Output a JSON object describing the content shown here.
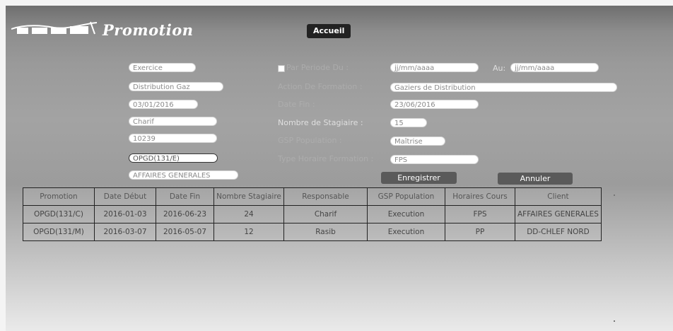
{
  "header": {
    "app_title": "Promotion"
  },
  "nav": {
    "items": [
      "Accueil"
    ]
  },
  "form": {
    "exercice_value": "Exercice",
    "par_periode_label": "Par Periode Du :",
    "date_du_value": "jj/mm/aaaa",
    "au_label": "Au:",
    "date_au_value": "jj/mm/aaaa",
    "distribution_value": "Distribution Gaz",
    "action_label": "Action De Formation :",
    "action_value": "Gaziers de Distribution",
    "date_debut_value": "03/01/2016",
    "date_fin_label": "Date Fin :",
    "date_fin_value": "23/06/2016",
    "responsable_value": "Charif",
    "nombre_label": "Nombre de Stagiaire :",
    "nombre_value": "15",
    "code_value": "10239",
    "gsp_label": "GSP Population :",
    "gsp_value": "Maîtrise",
    "promotion_value": "OPGD(131/E)",
    "type_horaire_label": "Type Horaire Formation :",
    "type_horaire_value": "FPS",
    "client_value": "AFFAIRES GENERALES"
  },
  "buttons": {
    "save": "Enregistrer",
    "cancel": "Annuler"
  },
  "table": {
    "headers": [
      "Promotion",
      "Date Début",
      "Date Fin",
      "Nombre Stagiaire",
      "Responsable",
      "GSP Population",
      "Horaires Cours",
      "Client"
    ],
    "rows": [
      [
        "OPGD(131/C)",
        "2016-01-03",
        "2016-06-23",
        "24",
        "Charif",
        "Execution",
        "FPS",
        "AFFAIRES GENERALES"
      ],
      [
        "OPGD(131/M)",
        "2016-03-07",
        "2016-05-07",
        "12",
        "Rasib",
        "Execution",
        "PP",
        "DD-CHLEF NORD"
      ]
    ]
  }
}
